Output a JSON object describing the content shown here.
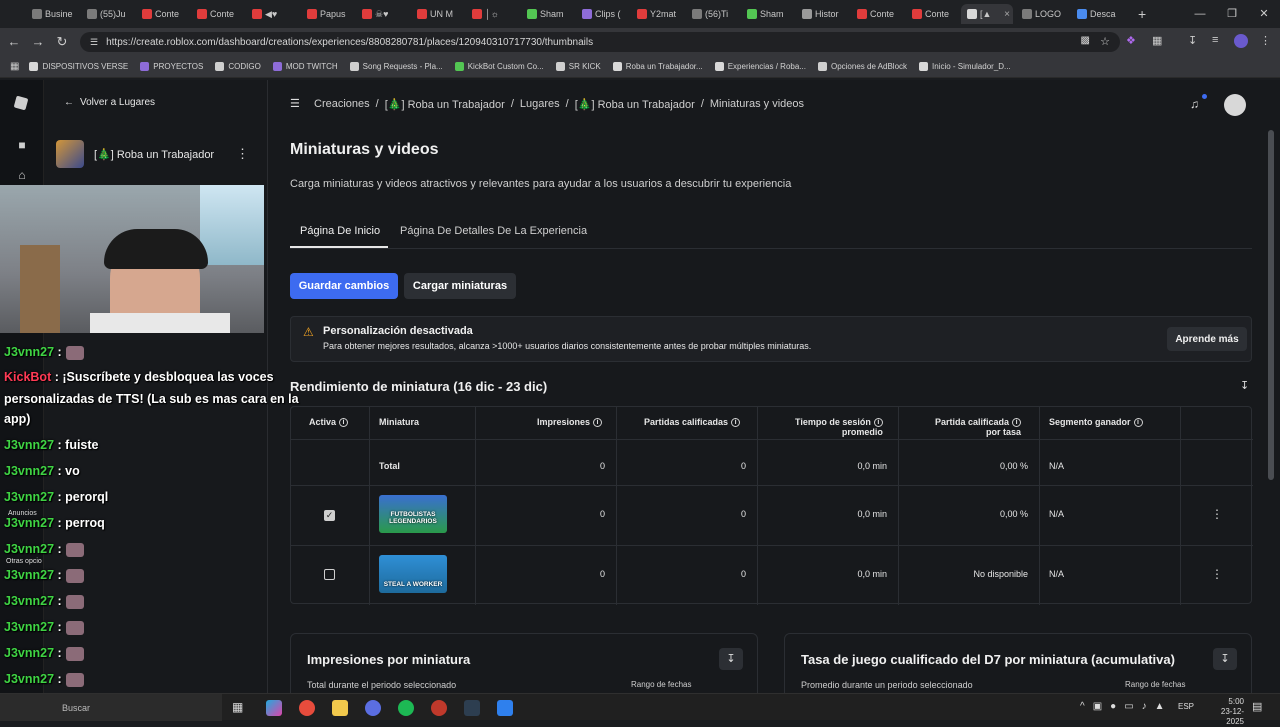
{
  "browser": {
    "tabs": [
      {
        "label": "Busine",
        "color": "#7b7b7b"
      },
      {
        "label": "(55)Ju",
        "color": "#7b7b7b"
      },
      {
        "label": "Conte",
        "color": "#e03c3c"
      },
      {
        "label": "Conte",
        "color": "#e03c3c"
      },
      {
        "label": "◀♥",
        "color": "#e03c3c"
      },
      {
        "label": "Papus",
        "color": "#e03c3c"
      },
      {
        "label": "☠♥",
        "color": "#e03c3c"
      },
      {
        "label": "UN M",
        "color": "#e03c3c"
      },
      {
        "label": "│☼",
        "color": "#e03c3c"
      },
      {
        "label": "Sham",
        "color": "#53c653"
      },
      {
        "label": "Clips (",
        "color": "#8e6cd8"
      },
      {
        "label": "Y2mat",
        "color": "#e03c3c"
      },
      {
        "label": "(56)Ti",
        "color": "#7b7b7b"
      },
      {
        "label": "Sham",
        "color": "#53c653"
      },
      {
        "label": "Histor",
        "color": "#9a9a9a"
      },
      {
        "label": "Conte",
        "color": "#e03c3c"
      },
      {
        "label": "Conte",
        "color": "#e03c3c"
      },
      {
        "label": "[▲",
        "color": "#d8d8d8"
      },
      {
        "label": "LOGO",
        "color": "#7b7b7b"
      },
      {
        "label": "Desca",
        "color": "#4a8cf0"
      }
    ],
    "url": "https://create.roblox.com/dashboard/creations/experiences/8808280781/places/120940310717730/thumbnails",
    "bookmarks": [
      {
        "label": "DISPOSITIVOS VERSE",
        "color": "#d8d8d8"
      },
      {
        "label": "PROYECTOS",
        "color": "#8e6cd8"
      },
      {
        "label": "CODIGO",
        "color": "#cfcfcf"
      },
      {
        "label": "MOD TWITCH",
        "color": "#8e6cd8"
      },
      {
        "label": "Song Requests - Pla...",
        "color": "#cfcfcf"
      },
      {
        "label": "KickBot Custom Co...",
        "color": "#53c653"
      },
      {
        "label": "SR KICK",
        "color": "#cfcfcf"
      },
      {
        "label": "Roba un Trabajador...",
        "color": "#d8d8d8"
      },
      {
        "label": "Experiencias / Roba...",
        "color": "#d8d8d8"
      },
      {
        "label": "Opciones de AdBlock",
        "color": "#cfcfcf"
      },
      {
        "label": "Inicio - Simulador_D...",
        "color": "#d8d8d8"
      }
    ]
  },
  "sidepanel": {
    "back_label": "Volver a Lugares",
    "experience_name": "[🎄] Roba un Trabajador"
  },
  "breadcrumb": {
    "items": [
      "Creaciones",
      "[🎄] Roba un Trabajador",
      "Lugares",
      "[🎄] Roba un Trabajador",
      "Miniaturas y videos"
    ],
    "sep": "/"
  },
  "page": {
    "title": "Miniaturas y videos",
    "subtitle": "Carga miniaturas y videos atractivos y relevantes para ayudar a los usuarios a descubrir tu experiencia",
    "tabs": [
      "Página De Inicio",
      "Página De Detalles De La Experiencia"
    ],
    "save_label": "Guardar cambios",
    "upload_label": "Cargar miniaturas"
  },
  "alert": {
    "title": "Personalización desactivada",
    "text": "Para obtener mejores resultados, alcanza >1000+ usuarios diarios consistentemente antes de probar múltiples miniaturas.",
    "link": "Aprende más"
  },
  "performance": {
    "title": "Rendimiento de miniatura (16 dic - 23 dic)",
    "headers": {
      "active": "Activa",
      "thumb": "Miniatura",
      "impressions": "Impresiones",
      "qualified": "Partidas calificadas",
      "session_1": "Tiempo de sesión",
      "session_2": "promedio",
      "rate_1": "Partida calificada",
      "rate_2": "por tasa",
      "winner": "Segmento ganador"
    },
    "rows": [
      {
        "label": "Total",
        "impressions": "0",
        "qualified": "0",
        "session": "0,0 min",
        "rate": "0,00 %",
        "winner": "N/A"
      },
      {
        "thumb_text": "FUTBOLISTAS LEGENDARIOS",
        "impressions": "0",
        "qualified": "0",
        "session": "0,0 min",
        "rate": "0,00 %",
        "winner": "N/A",
        "checked": true
      },
      {
        "thumb_text": "STEAL A WORKER",
        "impressions": "0",
        "qualified": "0",
        "session": "0,0 min",
        "rate": "No disponible",
        "winner": "N/A",
        "checked": false
      }
    ]
  },
  "cards": [
    {
      "title": "Impresiones por miniatura",
      "subtitle": "Total durante el periodo seleccionado",
      "range": "Rango de fechas"
    },
    {
      "title": "Tasa de juego cualificado del D7 por miniatura (acumulativa)",
      "subtitle": "Promedio durante un periodo seleccionado",
      "range": "Rango de fechas"
    }
  ],
  "overlay_chat": [
    {
      "user": "J3vnn27",
      "text": ":",
      "emote": true,
      "kind": "user"
    },
    {
      "user": "KickBot",
      "text": ": ¡Suscríbete y desbloquea las voces",
      "kind": "bot"
    },
    {
      "user": "",
      "text": "personalizadas de TTS! (La sub es mas cara en la",
      "kind": "cont"
    },
    {
      "user": "",
      "text": "app)",
      "kind": "cont"
    },
    {
      "user": "J3vnn27",
      "text": ": fuiste",
      "kind": "user"
    },
    {
      "user": "J3vnn27",
      "text": ": vo",
      "kind": "user"
    },
    {
      "user": "J3vnn27",
      "text": ": perorql",
      "kind": "user"
    },
    {
      "user": "J3vnn27",
      "text": ": perroq",
      "kind": "user"
    },
    {
      "user": "J3vnn27",
      "text": ":",
      "emote": true,
      "kind": "user"
    },
    {
      "user": "J3vnn27",
      "text": ":",
      "emote": true,
      "kind": "user"
    },
    {
      "user": "J3vnn27",
      "text": ":",
      "emote": true,
      "kind": "user"
    },
    {
      "user": "J3vnn27",
      "text": ":",
      "emote": true,
      "kind": "user"
    },
    {
      "user": "J3vnn27",
      "text": ":",
      "emote": true,
      "kind": "user"
    },
    {
      "user": "J3vnn27",
      "text": ":",
      "emote": true,
      "kind": "user"
    },
    {
      "user": "J3vnn27",
      "text": "",
      "kind": "user"
    }
  ],
  "leftnav_labels": [
    "Anuncios",
    "Otras opcio"
  ],
  "taskbar": {
    "search": "Buscar",
    "lang": "ESP",
    "time": "5:00",
    "date": "23-12-2025"
  },
  "colors": {
    "accent": "#3d6bf0",
    "warning": "#f5a623",
    "chat_user": "#3fd344",
    "chat_bot": "#ff3a55"
  }
}
